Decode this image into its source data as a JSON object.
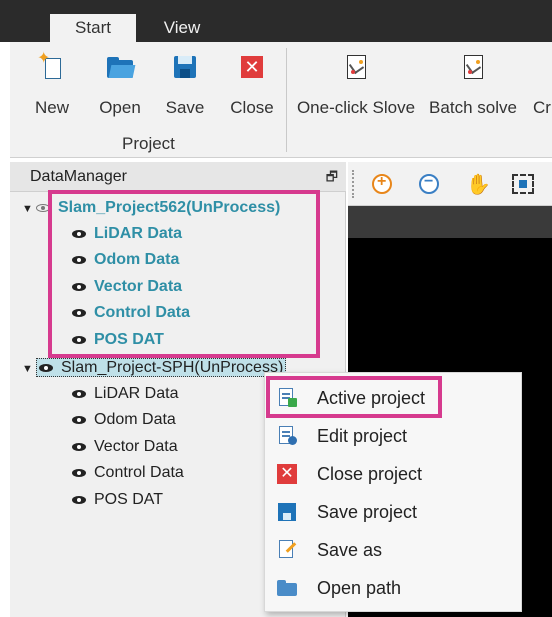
{
  "tabs": {
    "start": "Start",
    "view": "View"
  },
  "ribbon": {
    "new_label": "New",
    "open_label": "Open",
    "save_label": "Save",
    "close_label": "Close",
    "group_label": "Project",
    "oneclick_label": "One-click Slove",
    "batch_label": "Batch solve",
    "cut_label": "Cr"
  },
  "panel": {
    "title": "DataManager"
  },
  "tree": {
    "project1": {
      "label": "Slam_Project562(UnProcess)",
      "children": [
        "LiDAR Data",
        "Odom Data",
        "Vector Data",
        "Control Data",
        "POS DAT"
      ]
    },
    "project2": {
      "label": "Slam_Project-SPH(UnProcess)",
      "children": [
        "LiDAR Data",
        "Odom Data",
        "Vector Data",
        "Control Data",
        "POS DAT"
      ]
    }
  },
  "context_menu": {
    "items": [
      "Active project",
      "Edit project",
      "Close project",
      "Save project",
      "Save as",
      "Open path"
    ]
  },
  "colors": {
    "highlight": "#d63a8e",
    "project_text": "#2f8fa6",
    "selection_bg": "#bfe0e8",
    "tabbar_bg": "#2b2b2b"
  },
  "icons": {
    "ribbon": [
      "new-icon",
      "open-folder-icon",
      "save-icon",
      "close-icon",
      "one-click-solve-icon",
      "batch-solve-icon"
    ],
    "toolbar": [
      "zoom-in-icon",
      "zoom-out-icon",
      "pan-hand-icon",
      "fit-view-icon"
    ],
    "menu": [
      "active-project-icon",
      "edit-project-icon",
      "close-project-icon",
      "save-project-icon",
      "save-as-icon",
      "open-path-icon"
    ]
  }
}
